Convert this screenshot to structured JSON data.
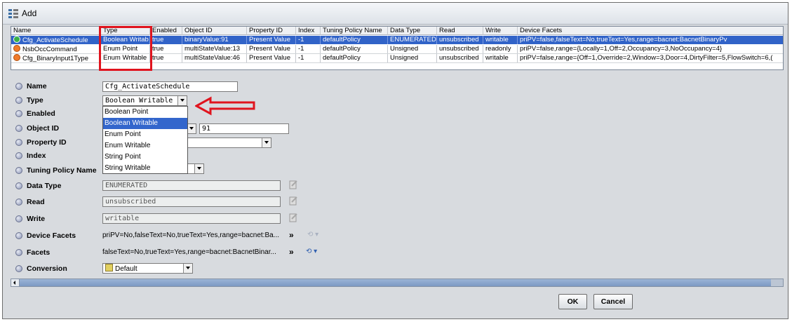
{
  "dialog": {
    "title": "Add"
  },
  "table": {
    "columns": [
      "Name",
      "Type",
      "Enabled",
      "Object ID",
      "Property ID",
      "Index",
      "Tuning Policy Name",
      "Data Type",
      "Read",
      "Write",
      "Device Facets"
    ],
    "rows": [
      {
        "name": "Cfg_ActivateSchedule",
        "type": "Boolean Writab",
        "enabled": "true",
        "object_id": "binaryValue:91",
        "property_id": "Present Value",
        "index": "-1",
        "tuning": "defaultPolicy",
        "data_type": "ENUMERATED",
        "read": "unsubscribed",
        "write": "writable",
        "facets": "priPV=false,falseText=No,trueText=Yes,range=bacnet:BacnetBinaryPv",
        "dot_color": "#38b04a",
        "selected": true
      },
      {
        "name": "NsbOccCommand",
        "type": "Enum Point",
        "enabled": "true",
        "object_id": "multiStateValue:13",
        "property_id": "Present Value",
        "index": "-1",
        "tuning": "defaultPolicy",
        "data_type": "Unsigned",
        "read": "unsubscribed",
        "write": "readonly",
        "facets": "priPV=false,range={Locally=1,Off=2,Occupancy=3,NoOccupancy=4}",
        "dot_color": "#f07a2a",
        "selected": false
      },
      {
        "name": "Cfg_BinaryInput1Type",
        "type": "Enum Writable",
        "enabled": "true",
        "object_id": "multiStateValue:46",
        "property_id": "Present Value",
        "index": "-1",
        "tuning": "defaultPolicy",
        "data_type": "Unsigned",
        "read": "unsubscribed",
        "write": "writable",
        "facets": "priPV=false,range={Off=1,Override=2,Window=3,Door=4,DirtyFilter=5,FlowSwitch=6,(",
        "dot_color": "#f07a2a",
        "selected": false
      }
    ]
  },
  "form": {
    "labels": {
      "name": "Name",
      "type": "Type",
      "enabled": "Enabled",
      "object_id": "Object ID",
      "property_id": "Property ID",
      "index": "Index",
      "tuning": "Tuning Policy Name",
      "data_type": "Data Type",
      "read": "Read",
      "write": "Write",
      "device_facets": "Device Facets",
      "facets": "Facets",
      "conversion": "Conversion"
    },
    "name_value": "Cfg_ActivateSchedule",
    "type_value": "Boolean Writable",
    "object_id_number": "91",
    "data_type_value": "ENUMERATED",
    "read_value": "unsubscribed",
    "write_value": "writable",
    "device_facets_value": "priPV=No,falseText=No,trueText=Yes,range=bacnet:Ba...",
    "facets_value": "falseText=No,trueText=Yes,range=bacnet:BacnetBinar...",
    "conversion_value": "Default",
    "more_glyph": "»"
  },
  "type_options": [
    "Boolean Point",
    "Boolean Writable",
    "Enum Point",
    "Enum Writable",
    "String Point",
    "String Writable"
  ],
  "type_options_highlighted": 1,
  "buttons": {
    "ok": "OK",
    "cancel": "Cancel"
  },
  "colors": {
    "selection": "#3163c8",
    "annotation_red": "#e0141e"
  }
}
